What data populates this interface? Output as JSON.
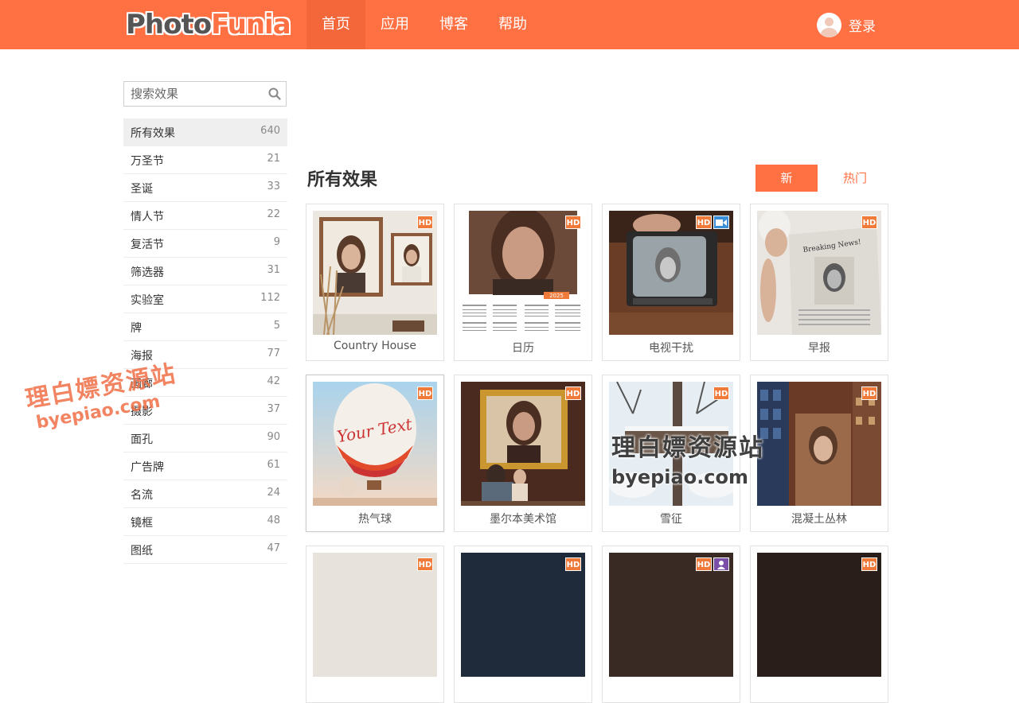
{
  "header": {
    "logo_part1": "Photo",
    "logo_part2": "Funia",
    "nav": [
      "首页",
      "应用",
      "博客",
      "帮助"
    ],
    "login_label": "登录"
  },
  "sidebar": {
    "search_placeholder": "搜索效果",
    "categories": [
      {
        "name": "所有效果",
        "count": "640"
      },
      {
        "name": "万圣节",
        "count": "21"
      },
      {
        "name": "圣诞",
        "count": "33"
      },
      {
        "name": "情人节",
        "count": "22"
      },
      {
        "name": "复活节",
        "count": "9"
      },
      {
        "name": "筛选器",
        "count": "31"
      },
      {
        "name": "实验室",
        "count": "112"
      },
      {
        "name": "牌",
        "count": "5"
      },
      {
        "name": "海报",
        "count": "77"
      },
      {
        "name": "画廊",
        "count": "42"
      },
      {
        "name": "摄影",
        "count": "37"
      },
      {
        "name": "面孔",
        "count": "90"
      },
      {
        "name": "广告牌",
        "count": "61"
      },
      {
        "name": "名流",
        "count": "24"
      },
      {
        "name": "镜框",
        "count": "48"
      },
      {
        "name": "图纸",
        "count": "47"
      }
    ]
  },
  "main": {
    "title": "所有效果",
    "sort_new": "新",
    "sort_hot": "热门",
    "hd_label": "HD",
    "calendar_year": "2025",
    "balloon_text": "Your Text",
    "newspaper_text": "Breaking News!",
    "cards": [
      {
        "label": "Country House"
      },
      {
        "label": "日历"
      },
      {
        "label": "电视干扰"
      },
      {
        "label": "早报"
      },
      {
        "label": "热气球"
      },
      {
        "label": "墨尔本美术馆"
      },
      {
        "label": "雪征"
      },
      {
        "label": "混凝土丛林"
      }
    ]
  },
  "watermark": {
    "cn": "理白嫖资源站",
    "url": "byepiao.com"
  },
  "colors": {
    "accent": "#ff7043",
    "hd_badge": "#f07a3a",
    "video_badge": "#3a8fd6",
    "person_badge": "#7b4fa8"
  }
}
